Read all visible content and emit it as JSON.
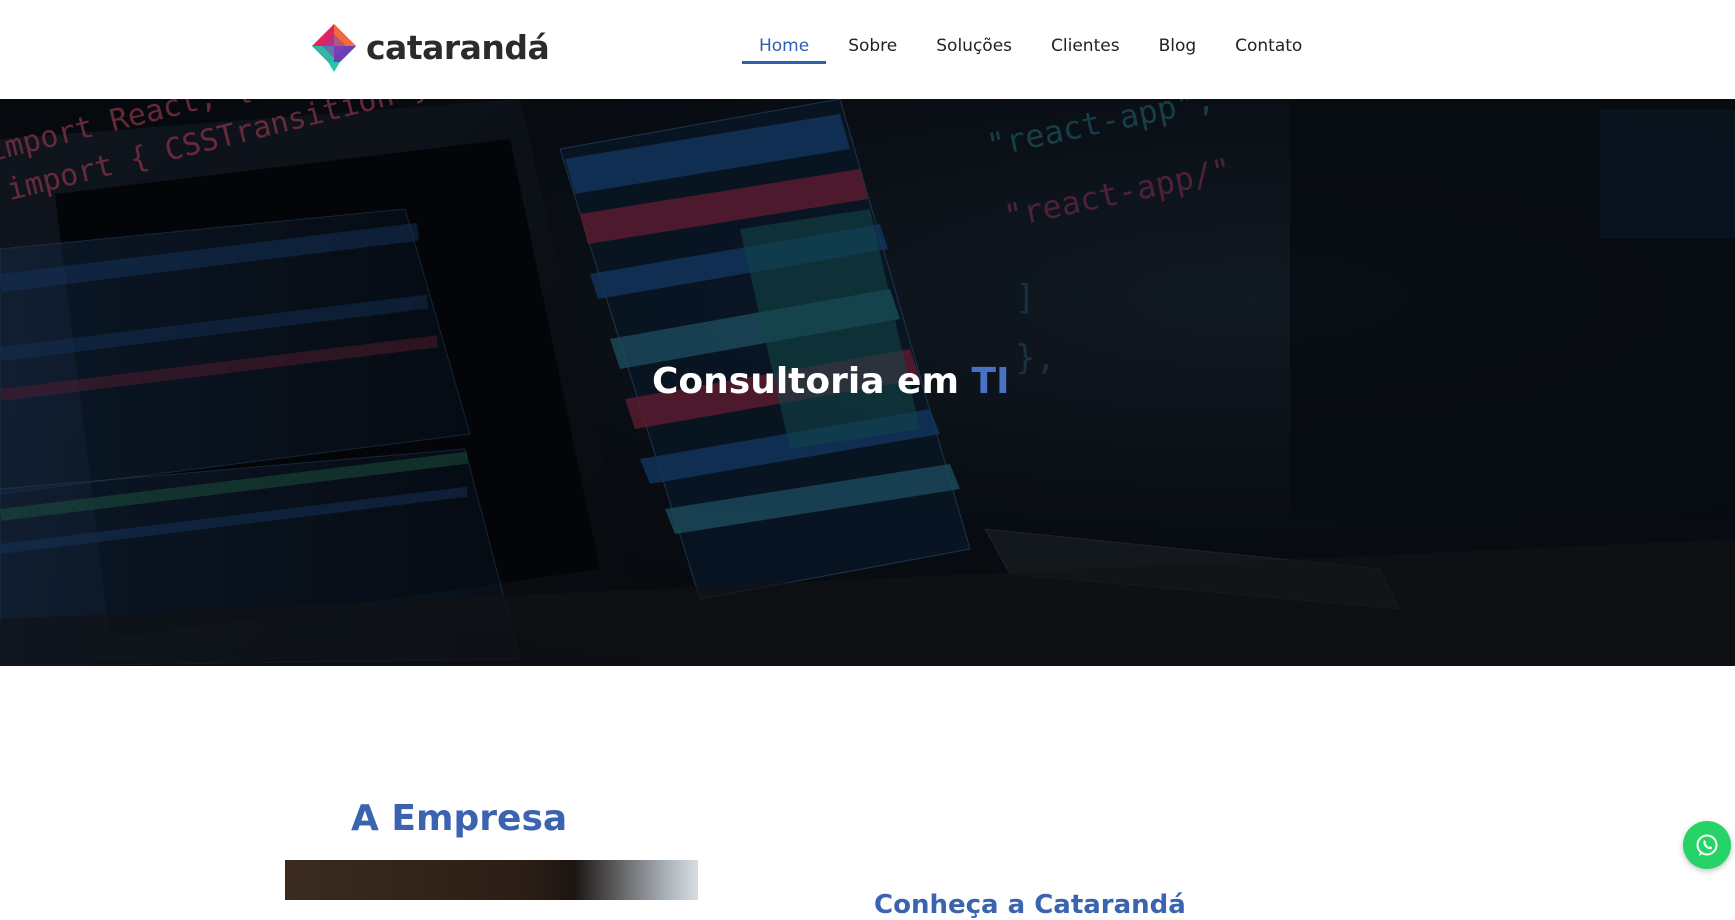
{
  "header": {
    "brand": "catarandá",
    "nav": [
      {
        "label": "Home",
        "active": true
      },
      {
        "label": "Sobre"
      },
      {
        "label": "Soluções"
      },
      {
        "label": "Clientes"
      },
      {
        "label": "Blog"
      },
      {
        "label": "Contato"
      }
    ]
  },
  "hero": {
    "title_main": "Consultoria em",
    "title_accent": "TI",
    "code_lines": [
      "import React, { useState, useEffect, useRef",
      "import { CSSTransition } from \"react-transition-group\"",
      "\"react-app\",",
      "\"react-app/\"",
      "]",
      "},"
    ]
  },
  "company": {
    "section_title": "A Empresa",
    "subheading": "Conheça a Catarandá"
  },
  "icons": {
    "logo_mark": "diamond-logo-icon",
    "whatsapp": "whatsapp-icon"
  },
  "colors": {
    "accent": "#3a63b0",
    "nav_active": "#2f5fae",
    "whatsapp": "#25d366"
  }
}
